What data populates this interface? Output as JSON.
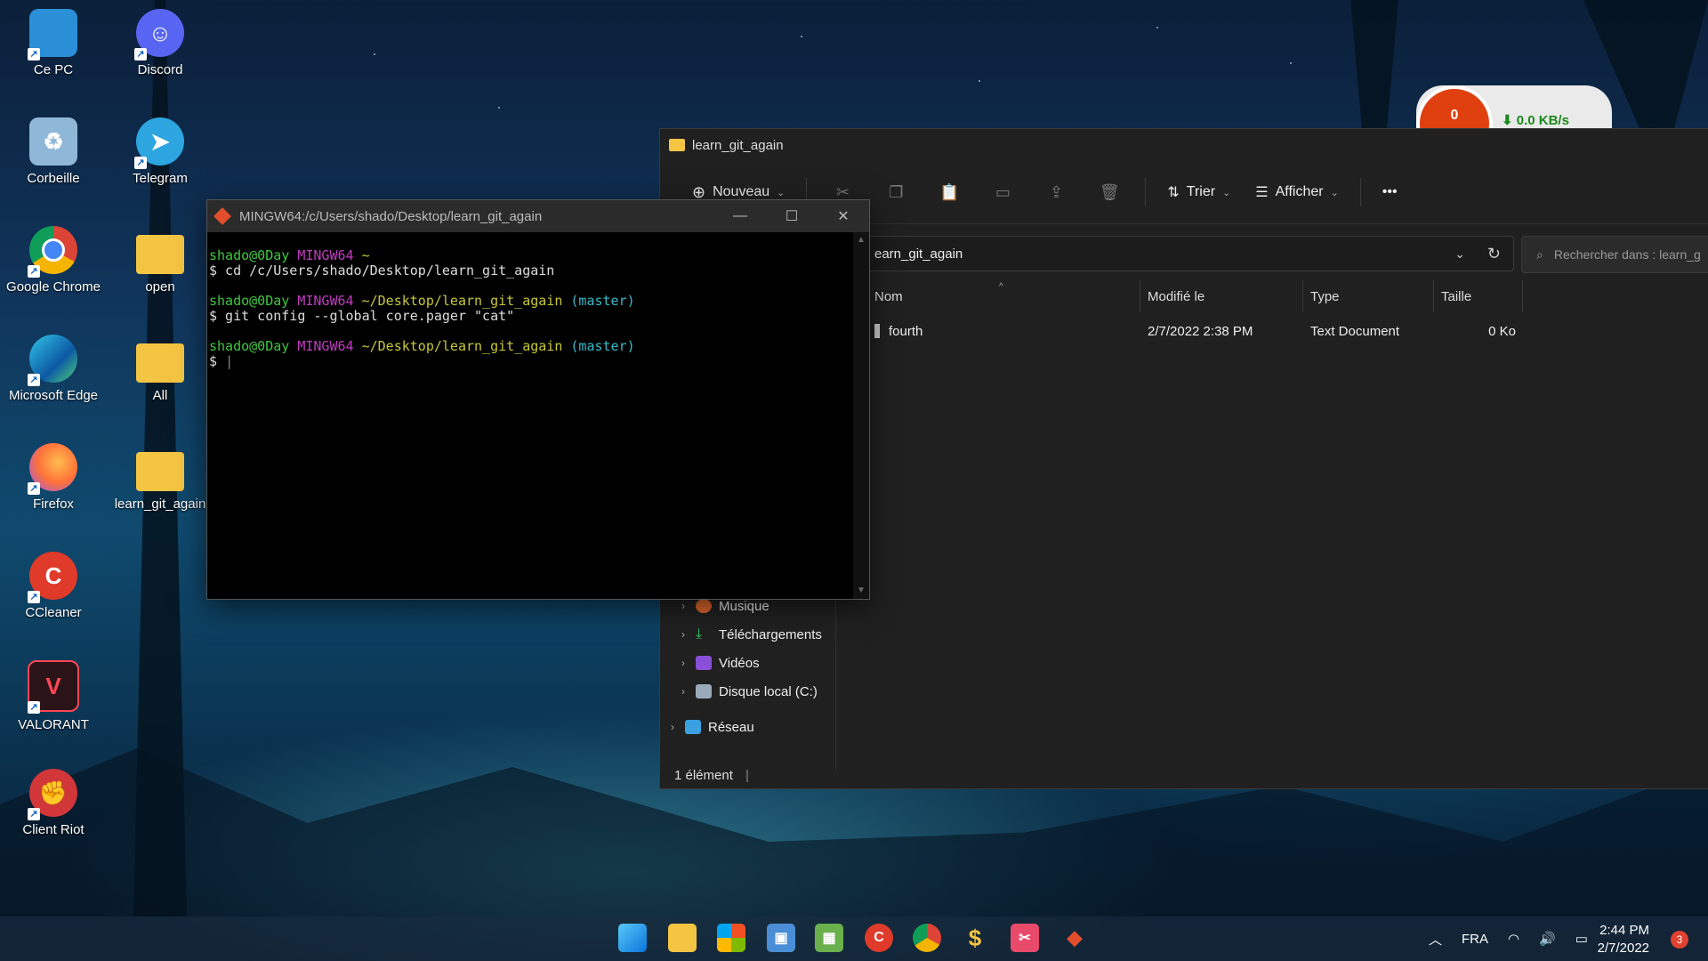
{
  "desktop": {
    "icons": [
      {
        "label": "Ce PC"
      },
      {
        "label": "Discord"
      },
      {
        "label": "Corbeille"
      },
      {
        "label": "Telegram"
      },
      {
        "label": "Google Chrome"
      },
      {
        "label": "open"
      },
      {
        "label": "Microsoft Edge"
      },
      {
        "label": "All"
      },
      {
        "label": "Firefox"
      },
      {
        "label": "learn_git_again"
      },
      {
        "label": "CCleaner"
      },
      {
        "label": "VALORANT"
      },
      {
        "label": "Client Riot"
      }
    ]
  },
  "network_widget": {
    "count": "0",
    "speed": "0.0 KB/s"
  },
  "explorer": {
    "title": "learn_git_again",
    "toolbar": {
      "new_label": "Nouveau",
      "sort_label": "Trier",
      "view_label": "Afficher",
      "more_label": "•••"
    },
    "address": "earn_git_again",
    "search_placeholder": "Rechercher dans : learn_g",
    "columns": {
      "name": "Nom",
      "modified": "Modifié le",
      "type": "Type",
      "size": "Taille"
    },
    "files": [
      {
        "name": "fourth",
        "modified": "2/7/2022 2:38 PM",
        "type": "Text Document",
        "size": "0 Ko"
      }
    ],
    "nav": [
      {
        "label": "Musique"
      },
      {
        "label": "Téléchargements"
      },
      {
        "label": "Vidéos"
      },
      {
        "label": "Disque local (C:)"
      },
      {
        "label": "Réseau"
      }
    ],
    "status": "1 élément"
  },
  "terminal": {
    "title": "MINGW64:/c/Users/shado/Desktop/learn_git_again",
    "prompt_user": "shado@0Day",
    "prompt_env": "MINGW64",
    "home": "~",
    "path": "~/Desktop/learn_git_again",
    "branch": "(master)",
    "cmd1": "$ cd /c/Users/shado/Desktop/learn_git_again",
    "cmd2": "$ git config --global core.pager \"cat\"",
    "cmd3": "$ "
  },
  "taskbar": {
    "language": "FRA",
    "time": "2:44 PM",
    "date": "2/7/2022",
    "notifications": "3"
  }
}
